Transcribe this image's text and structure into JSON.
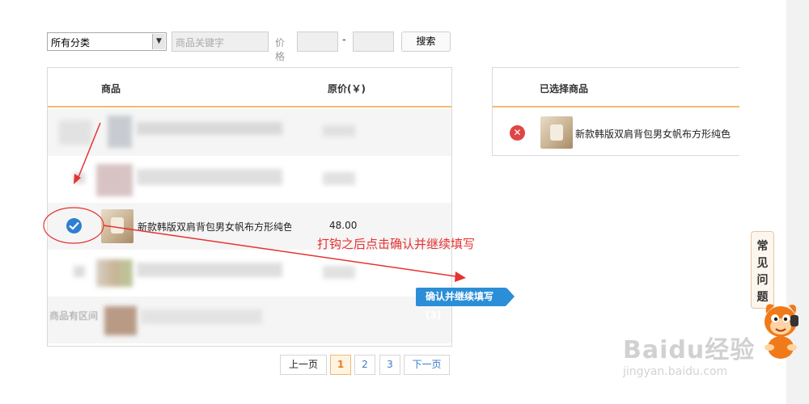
{
  "filter": {
    "category_value": "所有分类",
    "keyword_placeholder": "商品关键字",
    "price_label": "价格",
    "price_dash": "-",
    "search_label": "搜索"
  },
  "product_table": {
    "header_product": "商品",
    "header_price": "原价(￥)",
    "selected_row": {
      "title": "新款韩版双肩背包男女帆布方形纯色",
      "price": "48.00",
      "checked": true
    },
    "partial_text": "商品有区间"
  },
  "selected_panel": {
    "header": "已选择商品",
    "items": [
      {
        "title": "新款韩版双肩背包男女帆布方形纯色"
      }
    ]
  },
  "confirm_button": {
    "label": "确认并继续填写(3)"
  },
  "annotation": {
    "text": "打钩之后点击确认并继续填写"
  },
  "pagination": {
    "prev": "上一页",
    "pages": [
      "1",
      "2",
      "3"
    ],
    "current": "1",
    "next": "下一页"
  },
  "faq_tab": {
    "chars": [
      "常",
      "见",
      "问",
      "题"
    ]
  },
  "watermark": {
    "brand": "Baidu经验",
    "url": "jingyan.baidu.com"
  },
  "colors": {
    "accent_orange": "#f5b971",
    "primary_blue": "#2b8ed6",
    "annotation_red": "#e63232",
    "remove_red": "#e04545"
  }
}
